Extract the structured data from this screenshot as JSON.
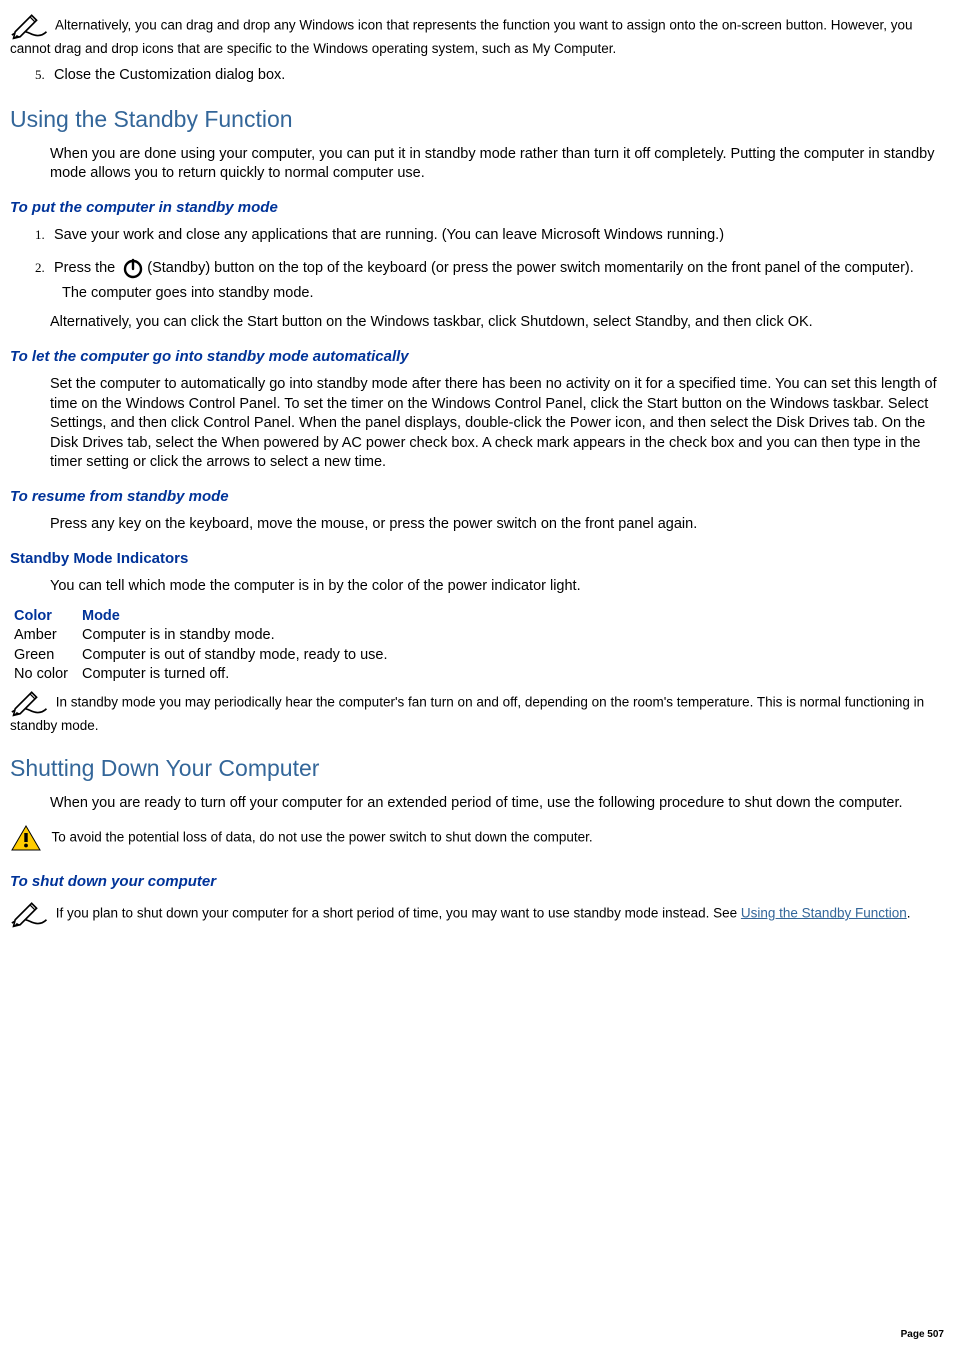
{
  "note1": "Alternatively, you can drag and drop any Windows icon that represents the function you want to assign onto the on-screen button. However, you cannot drag and drop icons that are specific to the Windows operating system, such as My Computer.",
  "step5": "Close the Customization dialog box.",
  "section1": {
    "heading": "Using the Standby Function",
    "intro": "When you are done using your computer, you can put it in standby mode rather than turn it off completely. Putting the computer in standby mode allows you to return quickly to normal computer use.",
    "sub1": {
      "heading": "To put the computer in standby mode",
      "step1": "Save your work and close any applications that are running. (You can leave Microsoft Windows running.)",
      "step2a": "Press the ",
      "step2b": "(Standby) button on the top of the keyboard (or press the power switch momentarily on the front panel of the computer).",
      "step2c": "The computer goes into standby mode.",
      "alt": "Alternatively, you can click the Start button on the Windows taskbar, click Shutdown, select Standby, and then click OK."
    },
    "sub2": {
      "heading": "To let the computer go into standby mode automatically",
      "body": "Set the computer to automatically go into standby mode after there has been no activity on it for a specified time. You can set this length of time on the Windows Control Panel. To set the timer on the Windows Control Panel, click the Start button on the Windows taskbar. Select Settings, and then click Control Panel. When the panel displays, double-click the Power icon, and then select the Disk Drives tab. On the Disk Drives tab, select the When powered by AC power check box. A check mark appears in the check box and you can then type in the timer setting or click the arrows to select a new time."
    },
    "sub3": {
      "heading": "To resume from standby mode",
      "body": "Press any key on the keyboard, move the mouse, or press the power switch on the front panel again."
    },
    "sub4": {
      "heading": "Standby Mode Indicators",
      "intro": "You can tell which mode the computer is in by the color of the power indicator light.",
      "table": {
        "h1": "Color",
        "h2": "Mode",
        "rows": [
          {
            "c1": "Amber",
            "c2": "Computer is in standby mode."
          },
          {
            "c1": "Green",
            "c2": "Computer is out of standby mode, ready to use."
          },
          {
            "c1": "No color",
            "c2": "Computer is turned off."
          }
        ]
      },
      "note": "In standby mode you may periodically hear the computer's fan turn on and off, depending on the room's temperature. This is normal functioning in standby mode."
    }
  },
  "section2": {
    "heading": "Shutting Down Your Computer",
    "intro": "When you are ready to turn off your computer for an extended period of time, use the following procedure to shut down the computer.",
    "warn": "To avoid the potential loss of data, do not use the power switch to shut down the computer.",
    "sub1": {
      "heading": "To shut down your computer",
      "note_a": "If you plan to shut down your computer for a short period of time, you may want to use standby mode instead. See ",
      "note_link": "Using the Standby Function",
      "note_b": "."
    }
  },
  "page_number": "Page 507"
}
